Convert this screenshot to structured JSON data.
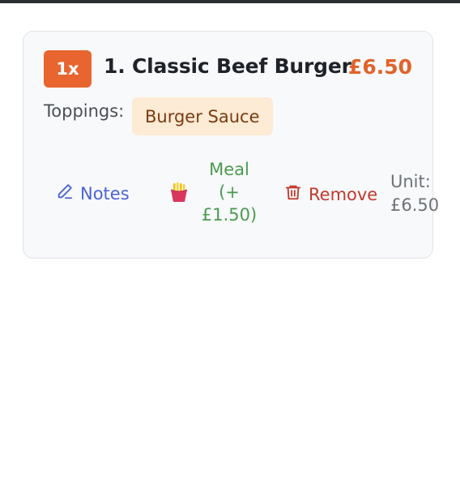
{
  "cart_item": {
    "quantity_label": "1x",
    "name": "1. Classic Beef Burger",
    "price": "£6.50",
    "toppings_label": "Toppings:",
    "toppings": [
      "Burger Sauce"
    ],
    "actions": {
      "notes_label": "Notes",
      "notes_icon": "pencil-icon",
      "meal_label": "Meal (+ £1.50)",
      "meal_icon": "fries-icon",
      "remove_label": "Remove",
      "remove_icon": "trash-icon"
    },
    "unit_label": "Unit:",
    "unit_price": "£6.50"
  },
  "colors": {
    "accent": "#e8652f",
    "price": "#e0632b",
    "notes": "#4a63d8",
    "meal": "#4a9a4f",
    "remove": "#c0392b",
    "chip_bg": "#fdebd5"
  }
}
